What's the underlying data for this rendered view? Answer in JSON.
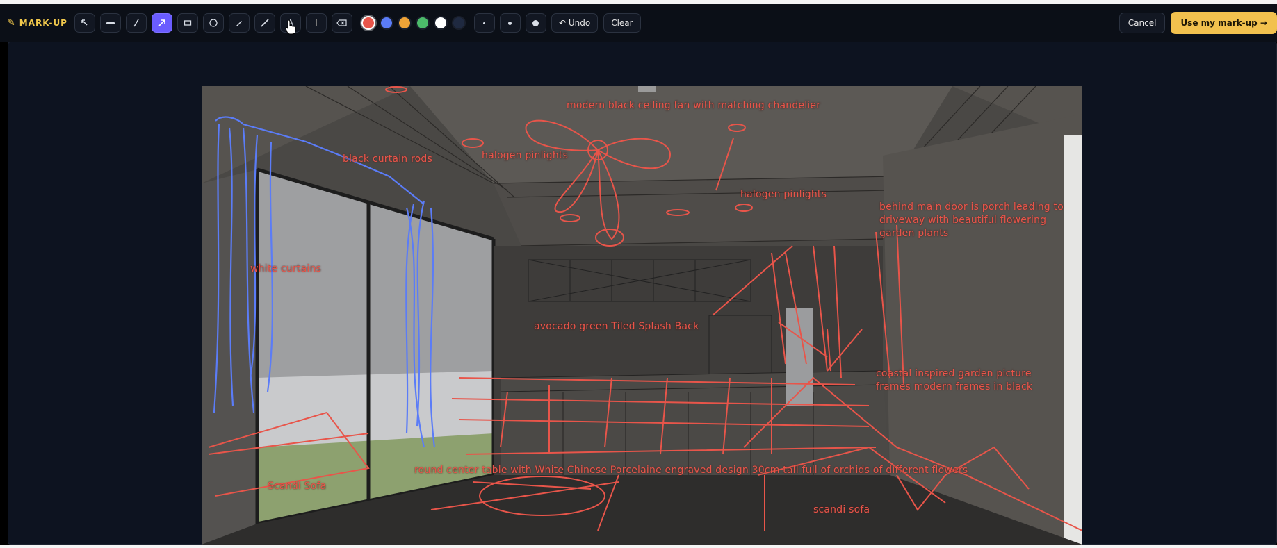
{
  "app": {
    "brand": "MARK-UP"
  },
  "toolbar": {
    "tools": [
      {
        "id": "select",
        "icon": "cursor-arrow-icon",
        "active": false
      },
      {
        "id": "highlight-line",
        "icon": "thick-line-icon",
        "active": false
      },
      {
        "id": "line",
        "icon": "line-icon",
        "active": false
      },
      {
        "id": "arrow",
        "icon": "arrow-icon",
        "active": true
      },
      {
        "id": "rectangle",
        "icon": "rectangle-icon",
        "active": false
      },
      {
        "id": "ellipse",
        "icon": "circle-icon",
        "active": false
      },
      {
        "id": "pen",
        "icon": "pen-icon",
        "active": false
      },
      {
        "id": "brush",
        "icon": "brush-icon",
        "active": false
      },
      {
        "id": "text",
        "icon": "text-icon",
        "active": false,
        "label": "A"
      },
      {
        "id": "marker",
        "icon": "marker-icon",
        "active": false
      },
      {
        "id": "eraser",
        "icon": "eraser-icon",
        "active": false
      }
    ],
    "colors": [
      {
        "hex": "#e8554a",
        "active": true
      },
      {
        "hex": "#5b7cf7",
        "active": false
      },
      {
        "hex": "#f0a437",
        "active": false
      },
      {
        "hex": "#4cbb6a",
        "active": false
      },
      {
        "hex": "#ffffff",
        "active": false
      },
      {
        "hex": "#1f2940",
        "active": false
      }
    ],
    "stroke_sizes": [
      "small-dot-icon",
      "medium-dot-icon",
      "large-dot-icon"
    ],
    "undo_label": "↶ Undo",
    "clear_label": "Clear",
    "cancel_label": "Cancel",
    "use_label": "Use my mark-up →"
  },
  "annotations": {
    "ceiling_fan": "modern black ceiling fan with matching chandelier",
    "halogen_left": "halogen pinlights",
    "halogen_right": "halogen pinlights",
    "curtain_rods": "black curtain rods",
    "white_curtains": "white curtains",
    "porch": "behind main door is porch leading to driveway with beautiful flowering garden plants",
    "splash_back": "avocado green Tiled Splash Back",
    "garden_frames": "coastal inspired garden picture frames modern frames in black",
    "center_table": "round center table with White Chinese Porcelaine engraved design 30cm tall full of orchids of different flowers",
    "scandi_sofa_left": "Scandi Sofa",
    "scandi_sofa_right": "scandi sofa"
  },
  "colors": {
    "annotation_red": "#e8554a",
    "annotation_blue": "#5b7cf7",
    "accent_yellow": "#f2c14e",
    "active_tool": "#6a5cff"
  }
}
